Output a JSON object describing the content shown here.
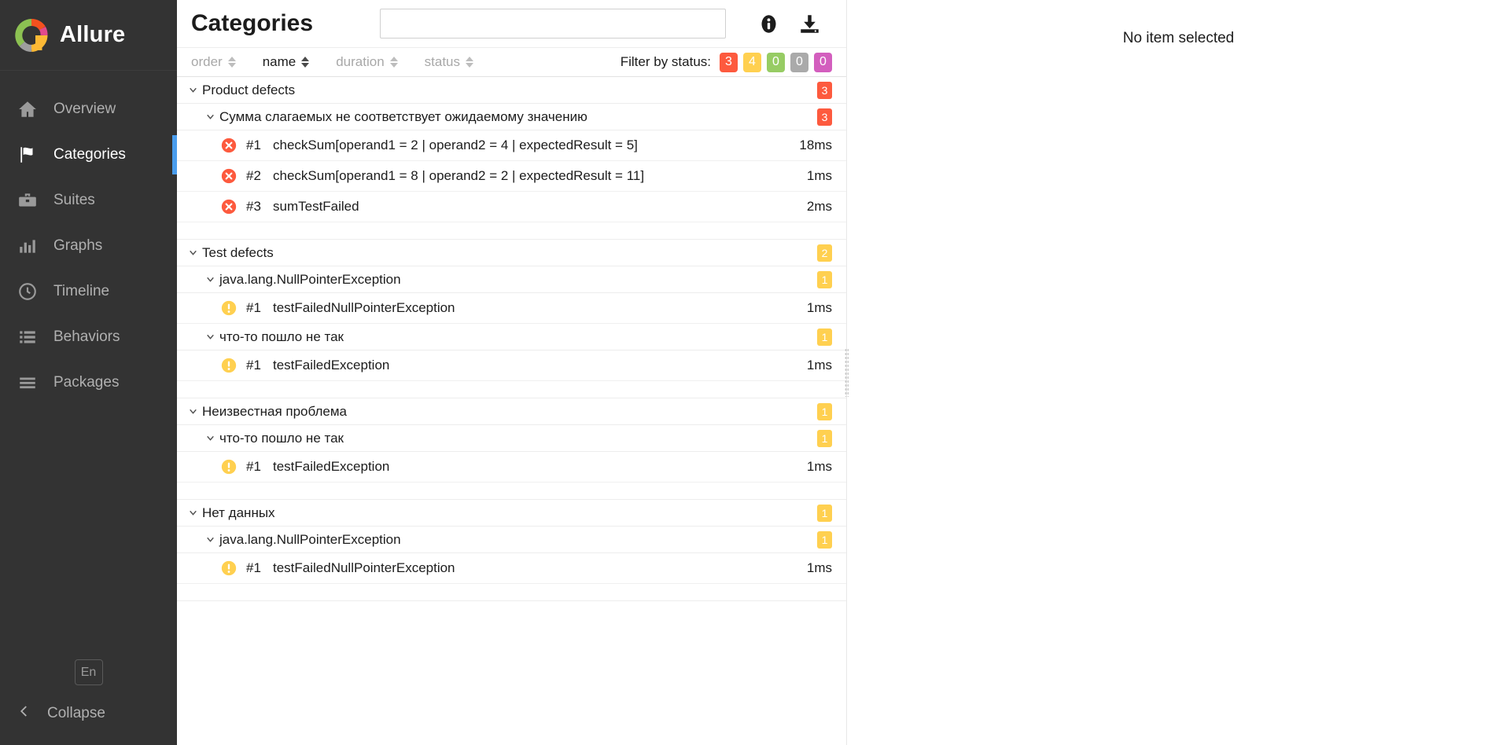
{
  "sidebar": {
    "brand": {
      "name": "Allure",
      "logo_icon": "allure-logo-icon"
    },
    "items": [
      {
        "label": "Overview",
        "icon": "home-icon",
        "active": false
      },
      {
        "label": "Categories",
        "icon": "flag-icon",
        "active": true
      },
      {
        "label": "Suites",
        "icon": "briefcase-icon",
        "active": false
      },
      {
        "label": "Graphs",
        "icon": "bar-chart-icon",
        "active": false
      },
      {
        "label": "Timeline",
        "icon": "clock-icon",
        "active": false
      },
      {
        "label": "Behaviors",
        "icon": "list-icon",
        "active": false
      },
      {
        "label": "Packages",
        "icon": "menu-icon",
        "active": false
      }
    ],
    "language_button": "En",
    "collapse_label": "Collapse",
    "collapse_icon": "chevron-left-icon",
    "accent_color": "#4a9ded",
    "background_color": "#333333"
  },
  "header": {
    "title": "Categories",
    "search_value": "",
    "search_placeholder": "",
    "info_icon": "info-icon",
    "download_icon": "download-icon"
  },
  "sortbar": {
    "columns": [
      {
        "label": "order",
        "active": false
      },
      {
        "label": "name",
        "active": true
      },
      {
        "label": "duration",
        "active": false
      },
      {
        "label": "status",
        "active": false
      }
    ],
    "filter_label": "Filter by status:",
    "chips": [
      {
        "count": "3",
        "status": "failed",
        "color": "#fd5a3e"
      },
      {
        "count": "4",
        "status": "broken",
        "color": "#ffd050"
      },
      {
        "count": "0",
        "status": "passed",
        "color": "#97cc64"
      },
      {
        "count": "0",
        "status": "skipped",
        "color": "#aaaaaa"
      },
      {
        "count": "0",
        "status": "unknown",
        "color": "#d35ebe"
      }
    ]
  },
  "tree": {
    "chevron_icon": "chevron-down-icon",
    "groups": [
      {
        "label": "Product defects",
        "badge": "3",
        "badge_color": "#fd5a3e",
        "children": [
          {
            "label": "Сумма слагаемых не соответствует ожидаемому значению",
            "badge": "3",
            "badge_color": "#fd5a3e",
            "tests": [
              {
                "order": "#1",
                "name": "checkSum[operand1 = 2 | operand2 = 4 | expectedResult = 5]",
                "duration": "18ms",
                "status": "failed",
                "status_icon": "failed-icon",
                "color": "#fd5a3e"
              },
              {
                "order": "#2",
                "name": "checkSum[operand1 = 8 | operand2 = 2 | expectedResult = 11]",
                "duration": "1ms",
                "status": "failed",
                "status_icon": "failed-icon",
                "color": "#fd5a3e"
              },
              {
                "order": "#3",
                "name": "sumTestFailed",
                "duration": "2ms",
                "status": "failed",
                "status_icon": "failed-icon",
                "color": "#fd5a3e"
              }
            ]
          }
        ]
      },
      {
        "label": "Test defects",
        "badge": "2",
        "badge_color": "#ffd050",
        "children": [
          {
            "label": "java.lang.NullPointerException",
            "badge": "1",
            "badge_color": "#ffd050",
            "tests": [
              {
                "order": "#1",
                "name": "testFailedNullPointerException",
                "duration": "1ms",
                "status": "broken",
                "status_icon": "broken-icon",
                "color": "#ffd050"
              }
            ]
          },
          {
            "label": "что-то пошло не так",
            "badge": "1",
            "badge_color": "#ffd050",
            "tests": [
              {
                "order": "#1",
                "name": "testFailedException",
                "duration": "1ms",
                "status": "broken",
                "status_icon": "broken-icon",
                "color": "#ffd050"
              }
            ]
          }
        ]
      },
      {
        "label": "Неизвестная проблема",
        "badge": "1",
        "badge_color": "#ffd050",
        "children": [
          {
            "label": "что-то пошло не так",
            "badge": "1",
            "badge_color": "#ffd050",
            "tests": [
              {
                "order": "#1",
                "name": "testFailedException",
                "duration": "1ms",
                "status": "broken",
                "status_icon": "broken-icon",
                "color": "#ffd050"
              }
            ]
          }
        ]
      },
      {
        "label": "Нет данных",
        "badge": "1",
        "badge_color": "#ffd050",
        "children": [
          {
            "label": "java.lang.NullPointerException",
            "badge": "1",
            "badge_color": "#ffd050",
            "tests": [
              {
                "order": "#1",
                "name": "testFailedNullPointerException",
                "duration": "1ms",
                "status": "broken",
                "status_icon": "broken-icon",
                "color": "#ffd050"
              }
            ]
          }
        ]
      }
    ]
  },
  "detail": {
    "empty_message": "No item selected"
  }
}
